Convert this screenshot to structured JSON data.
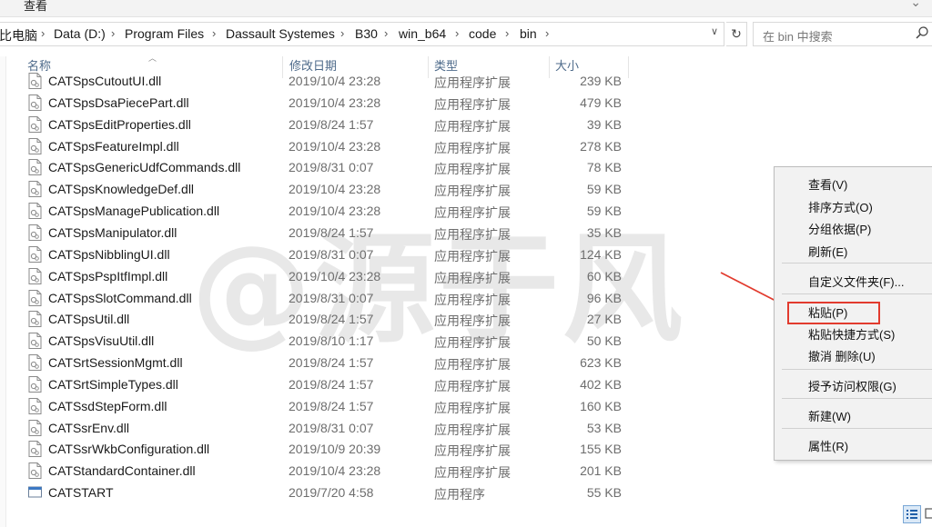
{
  "ribbon": {
    "label": "查看"
  },
  "address": {
    "crumbs": [
      "比电脑",
      "Data (D:)",
      "Program Files",
      "Dassault Systemes",
      "B30",
      "win_b64",
      "code",
      "bin"
    ],
    "search_placeholder": "在 bin 中搜索"
  },
  "columns": {
    "name": "名称",
    "date": "修改日期",
    "type": "类型",
    "size": "大小"
  },
  "files": [
    {
      "name": "CATSpsCutoutUI.dll",
      "date": "2019/10/4 23:28",
      "type": "应用程序扩展",
      "size": "239 KB"
    },
    {
      "name": "CATSpsDsaPiecePart.dll",
      "date": "2019/10/4 23:28",
      "type": "应用程序扩展",
      "size": "479 KB"
    },
    {
      "name": "CATSpsEditProperties.dll",
      "date": "2019/8/24 1:57",
      "type": "应用程序扩展",
      "size": "39 KB"
    },
    {
      "name": "CATSpsFeatureImpl.dll",
      "date": "2019/10/4 23:28",
      "type": "应用程序扩展",
      "size": "278 KB"
    },
    {
      "name": "CATSpsGenericUdfCommands.dll",
      "date": "2019/8/31 0:07",
      "type": "应用程序扩展",
      "size": "78 KB"
    },
    {
      "name": "CATSpsKnowledgeDef.dll",
      "date": "2019/10/4 23:28",
      "type": "应用程序扩展",
      "size": "59 KB"
    },
    {
      "name": "CATSpsManagePublication.dll",
      "date": "2019/10/4 23:28",
      "type": "应用程序扩展",
      "size": "59 KB"
    },
    {
      "name": "CATSpsManipulator.dll",
      "date": "2019/8/24 1:57",
      "type": "应用程序扩展",
      "size": "35 KB"
    },
    {
      "name": "CATSpsNibblingUI.dll",
      "date": "2019/8/31 0:07",
      "type": "应用程序扩展",
      "size": "124 KB"
    },
    {
      "name": "CATSpsPspItfImpl.dll",
      "date": "2019/10/4 23:28",
      "type": "应用程序扩展",
      "size": "60 KB"
    },
    {
      "name": "CATSpsSlotCommand.dll",
      "date": "2019/8/31 0:07",
      "type": "应用程序扩展",
      "size": "96 KB"
    },
    {
      "name": "CATSpsUtil.dll",
      "date": "2019/8/24 1:57",
      "type": "应用程序扩展",
      "size": "27 KB"
    },
    {
      "name": "CATSpsVisuUtil.dll",
      "date": "2019/8/10 1:17",
      "type": "应用程序扩展",
      "size": "50 KB"
    },
    {
      "name": "CATSrtSessionMgmt.dll",
      "date": "2019/8/24 1:57",
      "type": "应用程序扩展",
      "size": "623 KB"
    },
    {
      "name": "CATSrtSimpleTypes.dll",
      "date": "2019/8/24 1:57",
      "type": "应用程序扩展",
      "size": "402 KB"
    },
    {
      "name": "CATSsdStepForm.dll",
      "date": "2019/8/24 1:57",
      "type": "应用程序扩展",
      "size": "160 KB"
    },
    {
      "name": "CATSsrEnv.dll",
      "date": "2019/8/31 0:07",
      "type": "应用程序扩展",
      "size": "53 KB"
    },
    {
      "name": "CATSsrWkbConfiguration.dll",
      "date": "2019/10/9 20:39",
      "type": "应用程序扩展",
      "size": "155 KB"
    },
    {
      "name": "CATStandardContainer.dll",
      "date": "2019/10/4 23:28",
      "type": "应用程序扩展",
      "size": "201 KB"
    },
    {
      "name": "CATSTART",
      "date": "2019/7/20 4:58",
      "type": "应用程序",
      "size": "55 KB",
      "icon": "exe"
    }
  ],
  "watermark": "@源于风",
  "context_menu": {
    "view": "查看(V)",
    "sort": "排序方式(O)",
    "group": "分组依据(P)",
    "refresh": "刷新(E)",
    "customize": "自定义文件夹(F)...",
    "paste": "粘贴(P)",
    "paste_shortcut": "粘贴快捷方式(S)",
    "undo_delete": "撤消 删除(U)",
    "grant_access": "授予访问权限(G)",
    "new": "新建(W)",
    "properties": "属性(R)"
  },
  "colors": {
    "highlight": "#e23b2e",
    "arrow": "#e23b2e",
    "header_text": "#4d6a8a"
  }
}
